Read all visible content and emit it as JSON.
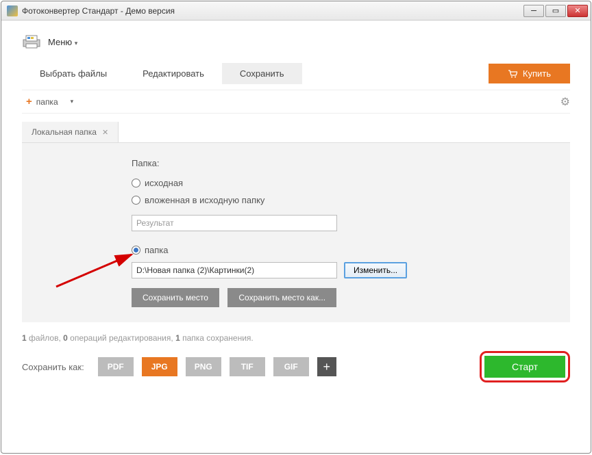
{
  "window": {
    "title": "Фотоконвертер Стандарт - Демо версия"
  },
  "menu": {
    "label": "Меню"
  },
  "tabs": {
    "select": "Выбрать файлы",
    "edit": "Редактировать",
    "save": "Сохранить"
  },
  "buy": {
    "label": "Купить"
  },
  "toolbar": {
    "add_folder": "папка"
  },
  "subtab": {
    "label": "Локальная папка"
  },
  "panel": {
    "folder_label": "Папка:",
    "radio_source": "исходная",
    "radio_nested": "вложенная в исходную папку",
    "nested_placeholder": "Результат",
    "radio_folder": "папка",
    "path_value": "D:\\Новая папка (2)\\Картинки(2)",
    "change_btn": "Изменить...",
    "save_place": "Сохранить место",
    "save_place_as": "Сохранить место как..."
  },
  "status": {
    "files_n": "1",
    "files_t": " файлов, ",
    "ops_n": "0",
    "ops_t": " операций редактирования, ",
    "folders_n": "1",
    "folders_t": " папка сохранения."
  },
  "bottom": {
    "save_as": "Сохранить как:",
    "formats": {
      "pdf": "PDF",
      "jpg": "JPG",
      "png": "PNG",
      "tif": "TIF",
      "gif": "GIF"
    },
    "start": "Старт"
  }
}
